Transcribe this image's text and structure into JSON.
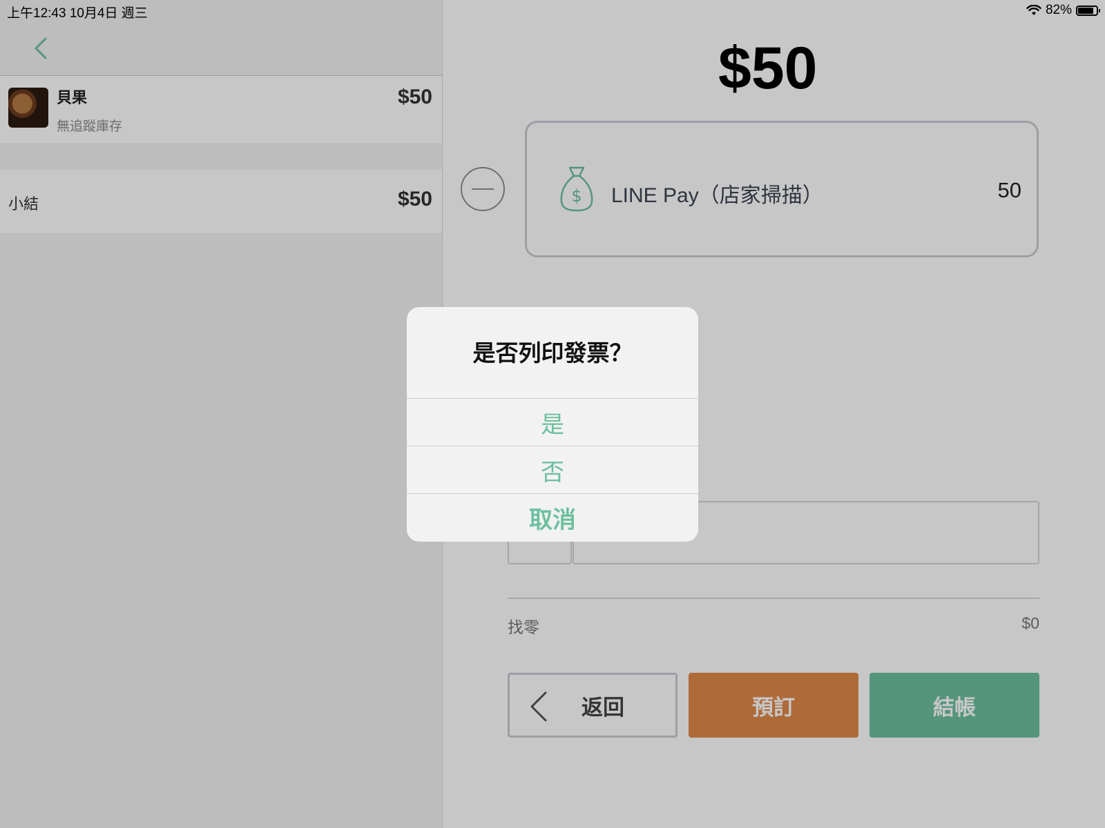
{
  "status_bar": {
    "time_date": "上午12:43   10月4日 週三",
    "battery": "82%"
  },
  "order": {
    "item": {
      "name": "貝果",
      "sub": "無追蹤庫存",
      "price": "$50"
    },
    "subtotal_label": "小結",
    "subtotal_value": "$50"
  },
  "payment": {
    "total": "$50",
    "method_name": "LINE Pay（店家掃描）",
    "method_amount": "50",
    "change_label": "找零",
    "change_value": "$0"
  },
  "buttons": {
    "back": "返回",
    "reserve": "預訂",
    "checkout": "結帳"
  },
  "alert": {
    "title": "是否列印發票？",
    "yes": "是",
    "no": "否",
    "cancel": "取消"
  },
  "colors": {
    "accent_green": "#6cbf9f",
    "accent_orange": "#e0884a"
  }
}
